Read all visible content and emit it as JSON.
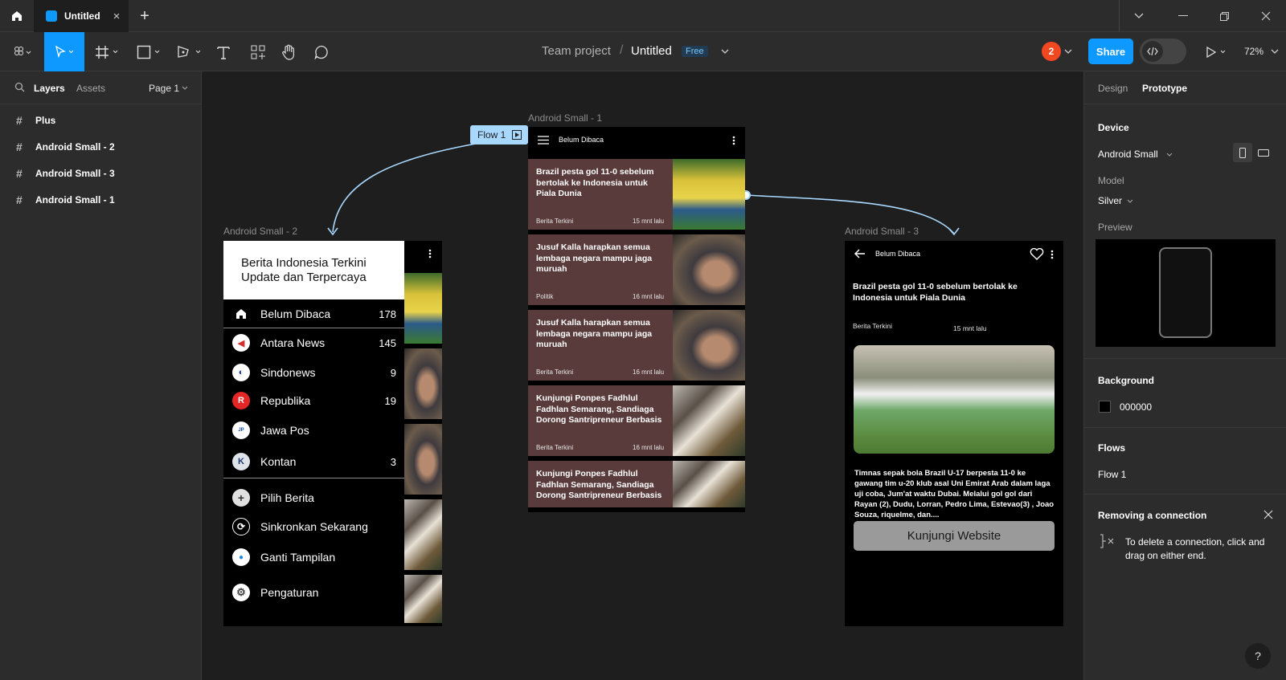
{
  "titlebar": {
    "tab_title": "Untitled",
    "new_tab": "+",
    "window_controls": [
      "chevron-down-icon",
      "minimize-icon",
      "restore-icon",
      "close-icon"
    ]
  },
  "toolbar": {
    "breadcrumb_team": "Team project",
    "breadcrumb_sep": "/",
    "file_name": "Untitled",
    "plan_badge": "Free",
    "avatar_count": "2",
    "share_label": "Share",
    "zoom": "72%"
  },
  "left_panel": {
    "tabs": [
      "Layers",
      "Assets"
    ],
    "page": "Page 1",
    "layers": [
      "Plus",
      "Android Small - 2",
      "Android Small - 3",
      "Android Small - 1"
    ]
  },
  "canvas": {
    "flow_label": "Flow 1",
    "frame1": {
      "label": "Android Small - 1",
      "header": "Belum Dibaca",
      "articles": [
        {
          "title": "Brazil pesta gol 11-0 sebelum bertolak ke Indonesia untuk Piala Dunia",
          "category": "Berita Terkini",
          "time": "15 mnt lalu"
        },
        {
          "title": "Jusuf Kalla harapkan semua lembaga negara mampu jaga muruah",
          "category": "Politik",
          "time": "16 mnt lalu"
        },
        {
          "title": "Jusuf Kalla harapkan semua lembaga negara mampu jaga muruah",
          "category": "Berita Terkini",
          "time": "16 mnt lalu"
        },
        {
          "title": "Kunjungi Ponpes Fadhlul Fadhlan Semarang, Sandiaga Dorong Santripreneur Berbasis",
          "category": "Berita Terkini",
          "time": "16 mnt lalu"
        },
        {
          "title": "Kunjungi Ponpes Fadhlul Fadhlan Semarang, Sandiaga Dorong Santripreneur Berbasis",
          "category": "",
          "time": ""
        }
      ]
    },
    "frame2": {
      "label": "Android Small - 2",
      "drawer_title_line1": "Berita Indonesia Terkini",
      "drawer_title_line2": "Update dan Terpercaya",
      "sources": [
        {
          "name": "Belum Dibaca",
          "count": "178",
          "icon": "home-icon"
        },
        {
          "name": "Antara News",
          "count": "145",
          "icon": "antara-logo-icon"
        },
        {
          "name": "Sindonews",
          "count": "9",
          "icon": "sindonews-logo-icon"
        },
        {
          "name": "Republika",
          "count": "19",
          "icon": "republika-logo-icon"
        },
        {
          "name": "Jawa Pos",
          "count": "",
          "icon": "jawapos-logo-icon"
        },
        {
          "name": "Kontan",
          "count": "3",
          "icon": "kontan-logo-icon"
        }
      ],
      "actions": [
        {
          "name": "Pilih Berita",
          "icon": "plus-icon"
        },
        {
          "name": "Sinkronkan Sekarang",
          "icon": "sync-icon"
        },
        {
          "name": "Ganti Tampilan",
          "icon": "drop-icon"
        },
        {
          "name": "Pengaturan",
          "icon": "gear-icon"
        }
      ]
    },
    "frame3": {
      "label": "Android Small - 3",
      "header": "Belum Dibaca",
      "title": "Brazil pesta gol 11-0 sebelum bertolak ke Indonesia untuk Piala Dunia",
      "category": "Berita Terkini",
      "time": "15 mnt lalu",
      "body": "Timnas sepak bola Brazil U-17 berpesta 11-0 ke gawang tim u-20 klub asal Uni Emirat Arab dalam laga uji coba, Jum'at waktu Dubai. Melalui gol gol dari Rayan (2), Dudu, Lorran, Pedro Lima, Estevao(3) , Joao Souza, riquelme, dan....",
      "button": "Kunjungi Website"
    }
  },
  "right_panel": {
    "tabs": [
      "Design",
      "Prototype"
    ],
    "device_heading": "Device",
    "device_value": "Android Small",
    "model_label": "Model",
    "model_value": "Silver",
    "preview_label": "Preview",
    "background_heading": "Background",
    "background_value": "000000",
    "flows_heading": "Flows",
    "flow_item": "Flow 1",
    "tip_heading": "Removing a connection",
    "tip_text": "To delete a connection, click and drag on either end.",
    "help": "?"
  },
  "colors": {
    "accent": "#0d99ff",
    "card_bg": "#5a3b3b",
    "connector": "#a8d8ff",
    "avatar": "#f24822"
  }
}
